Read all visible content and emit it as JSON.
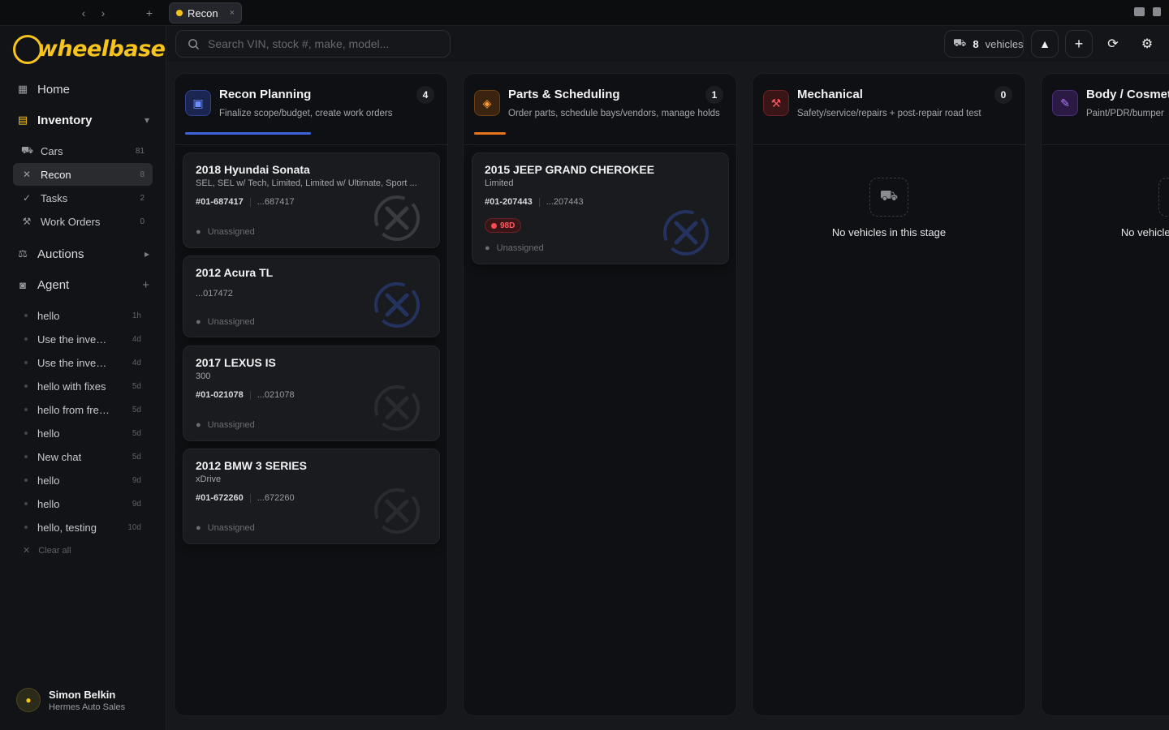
{
  "tabbar": {
    "tab_label": "Recon",
    "close": "×",
    "nav_back": "‹",
    "nav_forward": "›",
    "new_tab": "+"
  },
  "sidebar": {
    "logo_text": "wheelbase",
    "nav": {
      "home": "Home",
      "inventory": "Inventory",
      "auctions": "Auctions",
      "agent": "Agent"
    },
    "inventory_items": [
      {
        "label": "Cars",
        "count": "81",
        "icon": "car-icon"
      },
      {
        "label": "Recon",
        "count": "8",
        "icon": "tools-icon"
      },
      {
        "label": "Tasks",
        "count": "2",
        "icon": "check-icon"
      },
      {
        "label": "Work Orders",
        "count": "0",
        "icon": "wrench-icon"
      }
    ],
    "chats": [
      {
        "title": "hello",
        "age": "1h"
      },
      {
        "title": "Use the invent...",
        "age": "4d"
      },
      {
        "title": "Use the invent...",
        "age": "4d"
      },
      {
        "title": "hello with fixes",
        "age": "5d"
      },
      {
        "title": "hello from fres...",
        "age": "5d"
      },
      {
        "title": "hello",
        "age": "5d"
      },
      {
        "title": "New chat",
        "age": "5d"
      },
      {
        "title": "hello",
        "age": "9d"
      },
      {
        "title": "hello",
        "age": "9d"
      },
      {
        "title": "hello, testing",
        "age": "10d"
      }
    ],
    "clear_all": "Clear all",
    "user": {
      "name": "Simon Belkin",
      "org": "Hermes Auto Sales"
    }
  },
  "toolbar": {
    "search_placeholder": "Search VIN, stock #, make, model...",
    "vehicle_count": "8",
    "vehicle_label": "vehicles"
  },
  "columns": [
    {
      "title": "Recon Planning",
      "subtitle": "Finalize scope/budget, create work orders",
      "count": "4",
      "accent": "#3f63d8",
      "progress": 0.48,
      "cards": [
        {
          "title": "2018 Hyundai Sonata",
          "subtitle": "SEL, SEL w/ Tech, Limited, Limited w/ Ultimate, Sport ...",
          "stock": "#01-687417",
          "vin": "...687417",
          "assignee": "Unassigned"
        },
        {
          "title": "2012 Acura TL",
          "subtitle": "",
          "stock": "",
          "vin": "...017472",
          "assignee": "Unassigned"
        },
        {
          "title": "2017 LEXUS IS",
          "subtitle": "300",
          "stock": "#01-021078",
          "vin": "...021078",
          "assignee": "Unassigned"
        },
        {
          "title": "2012 BMW 3 SERIES",
          "subtitle": "xDrive",
          "stock": "#01-672260",
          "vin": "...672260",
          "assignee": "Unassigned"
        }
      ]
    },
    {
      "title": "Parts & Scheduling",
      "subtitle": "Order parts, schedule bays/vendors, manage holds",
      "count": "1",
      "accent": "#e8741e",
      "progress": 0.12,
      "cards": [
        {
          "title": "2015 JEEP GRAND CHEROKEE",
          "subtitle": "Limited",
          "stock": "#01-207443",
          "vin": "...207443",
          "badge": "98D",
          "assignee": "Unassigned"
        }
      ]
    },
    {
      "title": "Mechanical",
      "subtitle": "Safety/service/repairs + post-repair road test",
      "count": "0",
      "accent": "#e0393f",
      "empty": "No vehicles in this stage"
    },
    {
      "title": "Body / Cosmetic",
      "subtitle": "Paint/PDR/bumper",
      "accent": "#9b5de5",
      "empty": "No vehicles in this stage"
    }
  ]
}
